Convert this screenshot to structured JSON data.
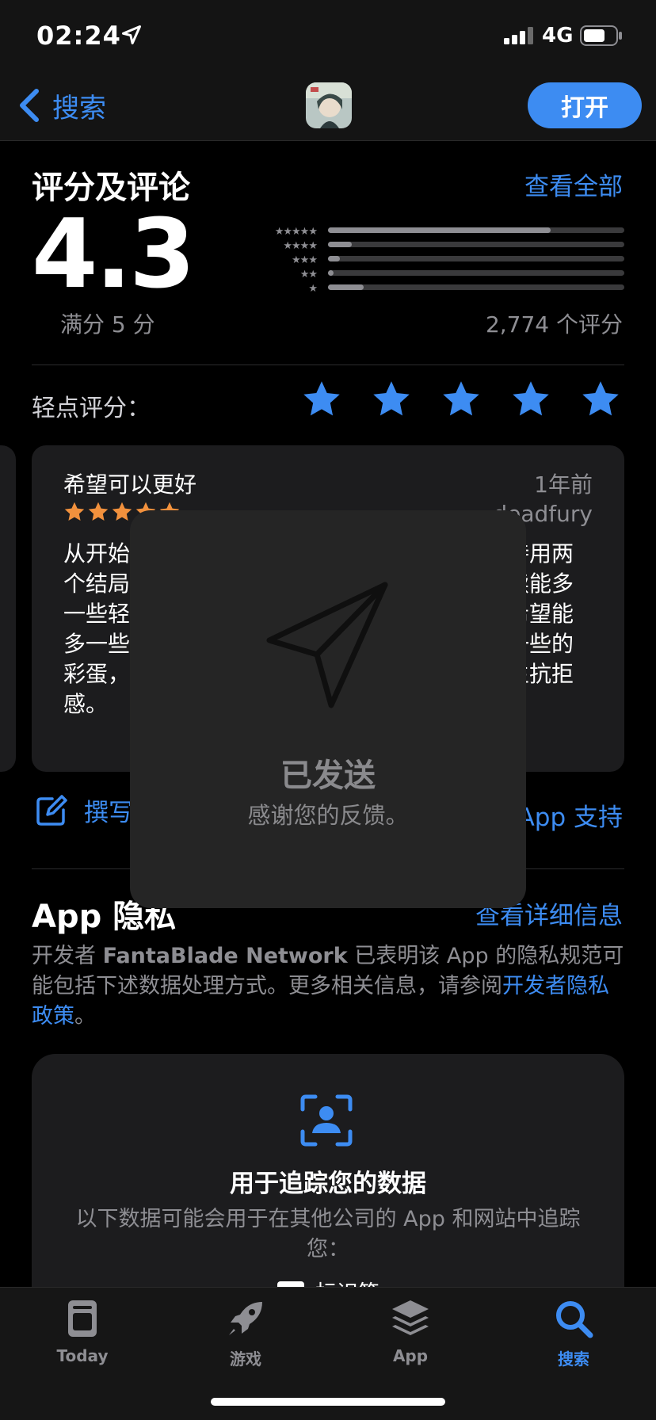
{
  "status_bar": {
    "time": "02:24",
    "network": "4G"
  },
  "nav": {
    "back_label": "搜索",
    "open_label": "打开"
  },
  "ratings": {
    "title": "评分及评论",
    "see_all": "查看全部",
    "score": "4.3",
    "out_of": "满分 5 分",
    "count": "2,774 个评分",
    "distribution": [
      0.75,
      0.08,
      0.04,
      0.02,
      0.12
    ],
    "tap_label": "轻点评分：",
    "tap_stars": 5
  },
  "review": {
    "title": "希望可以更好",
    "date": "1年前",
    "author": "deadfury",
    "stars": 5,
    "body": "从开始玩就能感觉到游戏剧情的用心，后来坚持用两个结局都看完了，也看到了结尾彩蛋。希望后续能多一些轻松的内容以欧一些哈哈的彩蛋也不错，希望能多一些的彩蛋多加入一些日常互动剧情，增加一些的彩蛋，这样玩家不会对游戏的整体剧情设定产生抗拒感。"
  },
  "actions": {
    "write_review": "撰写评论",
    "app_support": "App 支持"
  },
  "privacy": {
    "title": "App 隐私",
    "details_link": "查看详细信息",
    "text_prefix": "开发者 ",
    "developer": "FantaBlade Network",
    "text_middle": " 已表明该 App 的隐私规范可能包括下述数据处理方式。更多相关信息，请参阅",
    "policy_link": "开发者隐私政策",
    "text_suffix": "。",
    "tracking_title": "用于追踪您的数据",
    "tracking_desc": "以下数据可能会用于在其他公司的 App 和网站中追踪您：",
    "tracking_item": "标识符"
  },
  "toast": {
    "title": "已发送",
    "subtitle": "感谢您的反馈。"
  },
  "tabs": [
    {
      "label": "Today",
      "icon": "today-icon",
      "active": false
    },
    {
      "label": "游戏",
      "icon": "rocket-icon",
      "active": false
    },
    {
      "label": "App",
      "icon": "app-stack-icon",
      "active": false
    },
    {
      "label": "搜索",
      "icon": "search-icon",
      "active": true
    }
  ],
  "colors": {
    "accent": "#3d8cf2",
    "review_star": "#f2913d",
    "background": "#000000",
    "card": "#1c1c1e"
  }
}
